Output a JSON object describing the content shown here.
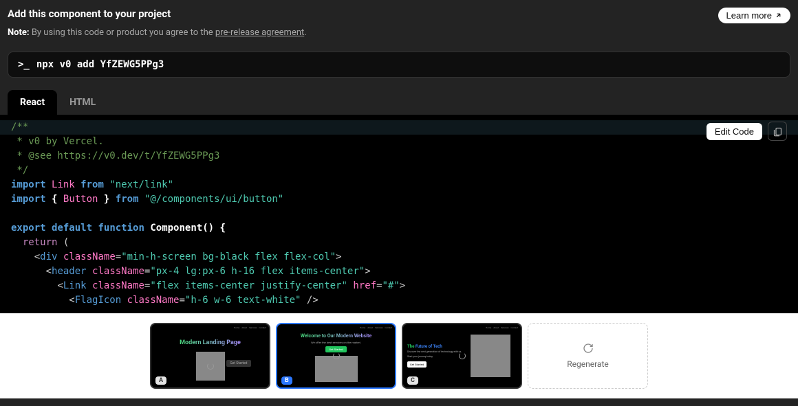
{
  "header": {
    "title": "Add this component to your project",
    "learn_more": "Learn more"
  },
  "note": {
    "bold": "Note:",
    "text": "By using this code or product you agree to the ",
    "link": "pre-release agreement",
    "tail": "."
  },
  "command": {
    "prompt": ">_",
    "text": "npx v0 add YfZEWG5PPg3"
  },
  "tabs": {
    "react": "React",
    "html": "HTML"
  },
  "toolbar": {
    "edit_code": "Edit Code"
  },
  "code": {
    "l1": "/**",
    "l2": " * v0 by Vercel.",
    "l3": " * @see https://v0.dev/t/YfZEWG5PPg3",
    "l4": " */",
    "l5_import": "import",
    "l5_link": "Link",
    "l5_from": "from",
    "l5_str": "\"next/link\"",
    "l6_import": "import",
    "l6_braces_o": "{",
    "l6_button": "Button",
    "l6_braces_c": "}",
    "l6_from": "from",
    "l6_str": "\"@/components/ui/button\"",
    "l8_export": "export",
    "l8_default": "default",
    "l8_function": "function",
    "l8_comp": "Component()",
    "l8_brace": "{",
    "l9_return": "return",
    "l9_paren": "(",
    "l10_open": "<",
    "l10_div": "div",
    "l10_cn": "className",
    "l10_eq": "=",
    "l10_str": "\"min-h-screen bg-black flex flex-col\"",
    "l10_close": ">",
    "l11_open": "<",
    "l11_tag": "header",
    "l11_cn": "className",
    "l11_eq": "=",
    "l11_str": "\"px-4 lg:px-6 h-16 flex items-center\"",
    "l11_close": ">",
    "l12_open": "<",
    "l12_tag": "Link",
    "l12_cn": "className",
    "l12_eq": "=",
    "l12_str": "\"flex items-center justify-center\"",
    "l12_href": "href",
    "l12_hrefstr": "\"#\"",
    "l12_close": ">",
    "l13_open": "<",
    "l13_tag": "FlagIcon",
    "l13_cn": "className",
    "l13_eq": "=",
    "l13_str": "\"h-6 w-6 text-white\"",
    "l13_close": "/>"
  },
  "thumbs": {
    "a": {
      "label": "A",
      "title": "Modern Landing Page",
      "btn": "Get Started"
    },
    "b": {
      "label": "B",
      "title": "Welcome to Our Modern Website",
      "sub": "We offer the best services on the market.",
      "btn": "Get Started"
    },
    "c": {
      "label": "C",
      "title_a": "The ",
      "title_b": "Future of Tech",
      "p1": "Discover the next generation of technology with us.",
      "p2": "Start your journey today.",
      "btn": "Get Started"
    }
  },
  "regenerate": "Regenerate"
}
